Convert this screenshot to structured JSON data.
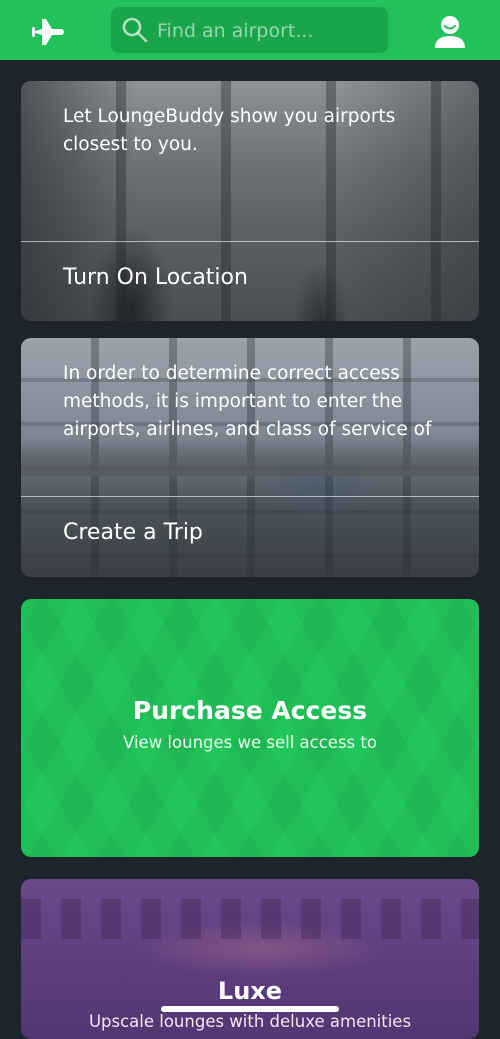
{
  "header": {
    "search_placeholder": "Find an airport...",
    "brand_color": "#22c25a"
  },
  "location_card": {
    "text": "Let LoungeBuddy show you airports closest to you.",
    "action": "Turn On Location"
  },
  "trip_card": {
    "text": "In order to determine correct access methods, it is important to enter the airports, airlines, and class of service of",
    "action": "Create a Trip"
  },
  "purchase_card": {
    "title": "Purchase Access",
    "subtitle": "View lounges we sell access to",
    "color": "#21c65a"
  },
  "luxe_card": {
    "title": "Luxe",
    "subtitle": "Upscale lounges with deluxe amenities"
  },
  "icons": {
    "left": "airplane-icon",
    "search": "search-icon",
    "right": "user-profile-icon"
  }
}
